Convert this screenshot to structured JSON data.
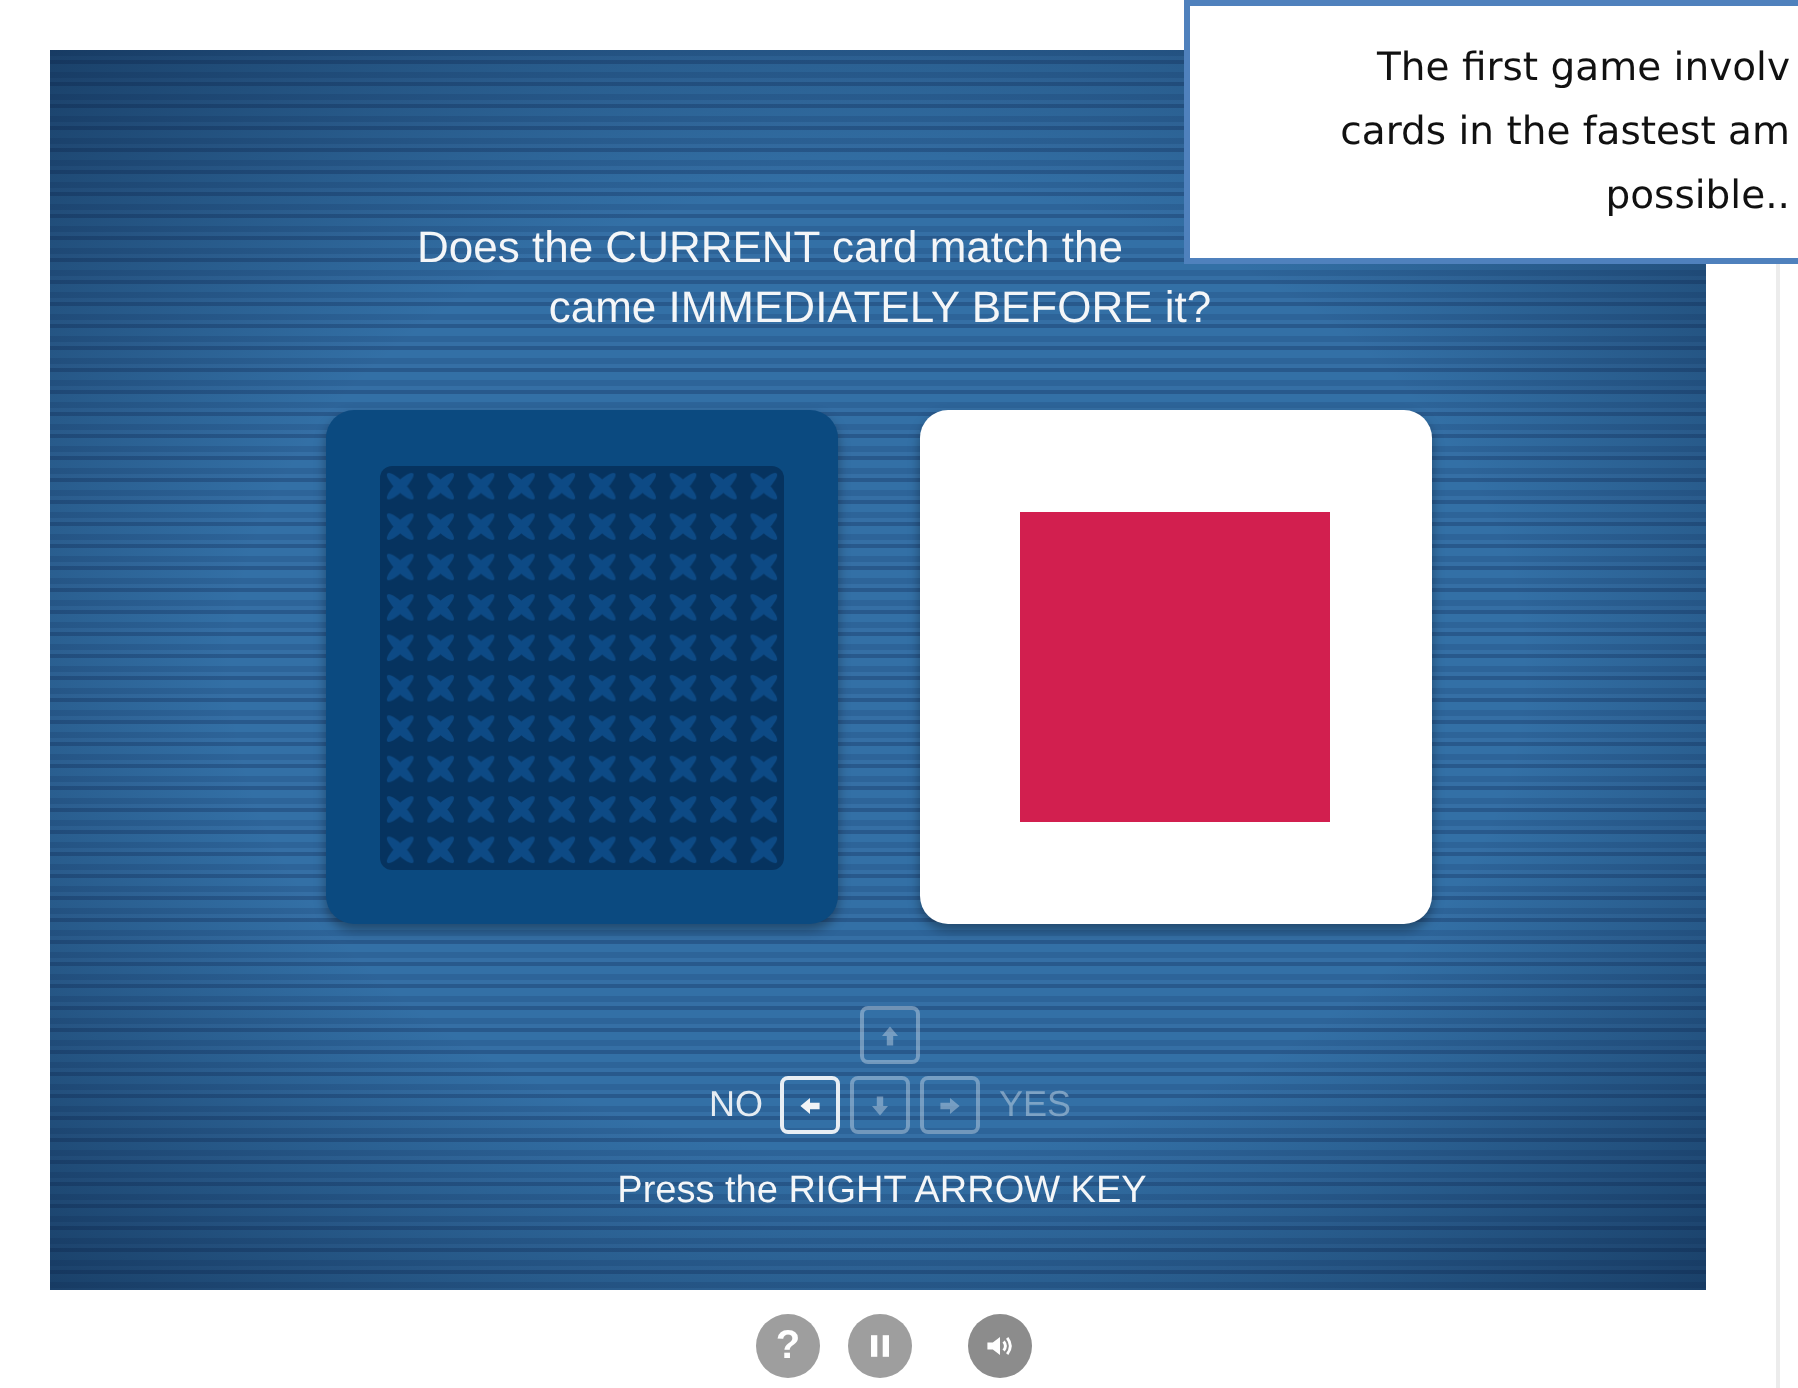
{
  "game": {
    "prompt": [
      "Does the CURRENT card match the",
      "came IMMEDIATELY BEFORE it?"
    ],
    "cards": [
      {
        "kind": "back"
      },
      {
        "kind": "face",
        "color": "#d21f4f"
      }
    ],
    "answer_no": "NO",
    "answer_yes": "YES",
    "keys": [
      {
        "kind": "up",
        "selected": false
      },
      {
        "kind": "left",
        "selected": true
      },
      {
        "kind": "down",
        "selected": false
      },
      {
        "kind": "right",
        "selected": false
      }
    ],
    "instruction": "Press the RIGHT ARROW KEY"
  },
  "controls": [
    {
      "kind": "help",
      "label": "?"
    },
    {
      "kind": "pause"
    },
    {
      "kind": "sound"
    }
  ],
  "callout": {
    "lines": [
      "The first game involv",
      "cards in the fastest am",
      "possible.."
    ]
  }
}
